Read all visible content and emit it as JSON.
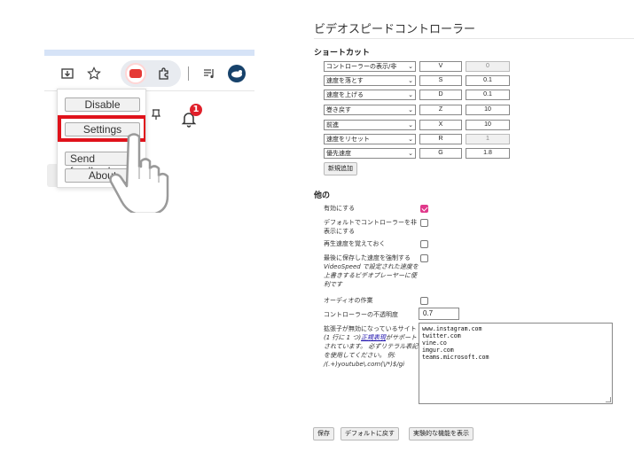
{
  "browser": {
    "notification_count": "1",
    "popup": {
      "disable_label": "Disable",
      "settings_label": "Settings",
      "feedback_label": "Send feedback",
      "about_label": "About"
    },
    "icons": [
      "download-icon",
      "star-icon",
      "video-speed-extension-icon",
      "extensions-puzzle-icon",
      "media-control-icon",
      "profile-avatar-icon",
      "bell-icon",
      "pin-icon",
      "hand-cursor-icon"
    ],
    "highlight_color": "#e0121b"
  },
  "options": {
    "title": "ビデオスピードコントローラー",
    "shortcuts_heading": "ショートカット",
    "shortcuts": [
      {
        "action": "コントローラーの表示/非",
        "key": "V",
        "value": "0",
        "value_disabled": true
      },
      {
        "action": "速度を落とす",
        "key": "S",
        "value": "0.1",
        "value_disabled": false
      },
      {
        "action": "速度を上げる",
        "key": "D",
        "value": "0.1",
        "value_disabled": false
      },
      {
        "action": "巻き戻す",
        "key": "Z",
        "value": "10",
        "value_disabled": false
      },
      {
        "action": "前進",
        "key": "X",
        "value": "10",
        "value_disabled": false
      },
      {
        "action": "速度をリセット",
        "key": "R",
        "value": "1",
        "value_disabled": true
      },
      {
        "action": "優先速度",
        "key": "G",
        "value": "1.8",
        "value_disabled": false
      }
    ],
    "add_new_label": "新規追加",
    "other_heading": "他の",
    "settings": {
      "enabled_label": "有効にする",
      "enabled_checked": true,
      "hide_default_label": "デフォルトでコントローラーを非表示にする",
      "hide_default_checked": false,
      "remember_speed_label": "再生速度を覚えておく",
      "remember_speed_checked": false,
      "force_speed_label_1": "最後に保存した速度を強制する",
      "force_speed_label_2": "VideoSpeed で設定された速度を上書きするビデオプレーヤーに便利です",
      "force_speed_checked": false,
      "audio_label": "オーディオの作業",
      "audio_checked": false,
      "opacity_label": "コントローラーの不透明度",
      "opacity_value": "0.7",
      "blacklist_label_1": "拡張子が無効になっているサイト",
      "blacklist_label_2": "(1 行に 1 つ)",
      "blacklist_link": "正規表現",
      "blacklist_label_3": "がサポートされています。 必ずリテラル表記を使用してください。 例: /(.+)youtube\\.com(\\/*)$/gi",
      "blacklist_value": "www.instagram.com\ntwitter.com\nvine.co\nimgur.com\nteams.microsoft.com"
    },
    "footer": {
      "save_label": "保存",
      "restore_label": "デフォルトに戻す",
      "experimental_label": "実験的な機能を表示"
    },
    "accent_color": "#e0398b"
  }
}
